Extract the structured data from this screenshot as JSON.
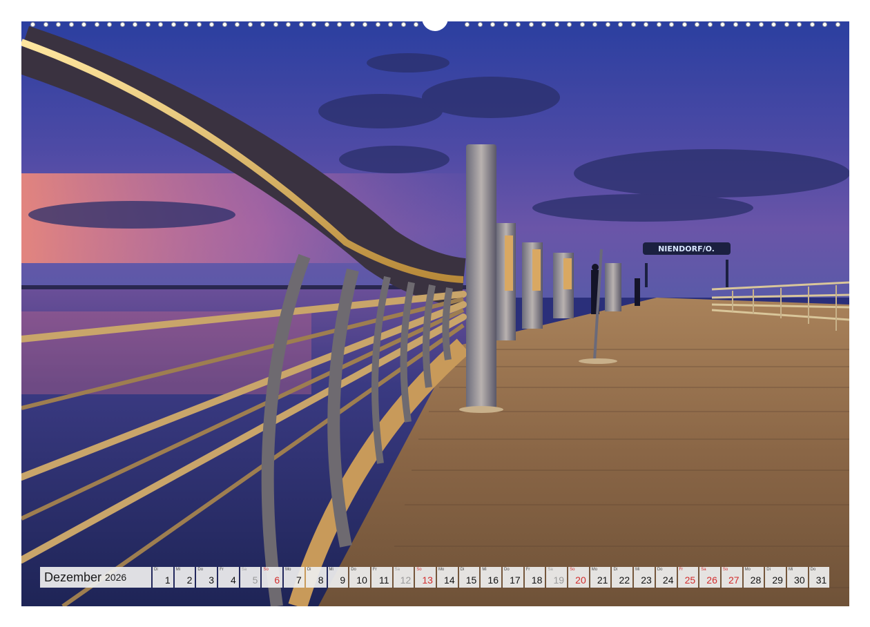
{
  "calendar": {
    "month": "Dezember",
    "year": "2026",
    "days": [
      {
        "d": "1",
        "wd": "Di",
        "type": "weekday"
      },
      {
        "d": "2",
        "wd": "Mi",
        "type": "weekday"
      },
      {
        "d": "3",
        "wd": "Do",
        "type": "weekday"
      },
      {
        "d": "4",
        "wd": "Fr",
        "type": "weekday"
      },
      {
        "d": "5",
        "wd": "Sa",
        "type": "sat"
      },
      {
        "d": "6",
        "wd": "So",
        "type": "sun"
      },
      {
        "d": "7",
        "wd": "Mo",
        "type": "weekday"
      },
      {
        "d": "8",
        "wd": "Di",
        "type": "weekday"
      },
      {
        "d": "9",
        "wd": "Mi",
        "type": "weekday"
      },
      {
        "d": "10",
        "wd": "Do",
        "type": "weekday"
      },
      {
        "d": "11",
        "wd": "Fr",
        "type": "weekday"
      },
      {
        "d": "12",
        "wd": "Sa",
        "type": "sat"
      },
      {
        "d": "13",
        "wd": "So",
        "type": "sun"
      },
      {
        "d": "14",
        "wd": "Mo",
        "type": "weekday"
      },
      {
        "d": "15",
        "wd": "Di",
        "type": "weekday"
      },
      {
        "d": "16",
        "wd": "Mi",
        "type": "weekday"
      },
      {
        "d": "17",
        "wd": "Do",
        "type": "weekday"
      },
      {
        "d": "18",
        "wd": "Fr",
        "type": "weekday"
      },
      {
        "d": "19",
        "wd": "Sa",
        "type": "sat"
      },
      {
        "d": "20",
        "wd": "So",
        "type": "sun"
      },
      {
        "d": "21",
        "wd": "Mo",
        "type": "weekday"
      },
      {
        "d": "22",
        "wd": "Di",
        "type": "weekday"
      },
      {
        "d": "23",
        "wd": "Mi",
        "type": "weekday"
      },
      {
        "d": "24",
        "wd": "Do",
        "type": "weekday"
      },
      {
        "d": "25",
        "wd": "Fr",
        "type": "holiday"
      },
      {
        "d": "26",
        "wd": "Sa",
        "type": "holiday"
      },
      {
        "d": "27",
        "wd": "So",
        "type": "sun"
      },
      {
        "d": "28",
        "wd": "Mo",
        "type": "weekday"
      },
      {
        "d": "29",
        "wd": "Di",
        "type": "weekday"
      },
      {
        "d": "30",
        "wd": "Mi",
        "type": "weekday"
      },
      {
        "d": "31",
        "wd": "Do",
        "type": "weekday"
      }
    ]
  },
  "photo": {
    "sign_text": "NIENDORF/O.",
    "colors": {
      "sky_top": "#2c3a8c",
      "sky_mid": "#5b4fa8",
      "sunset": "#e0708a",
      "water": "#2a3378",
      "deck": "#8a6a4a",
      "rail_light": "#ffd27a",
      "holiday": "#d22b2b"
    }
  }
}
